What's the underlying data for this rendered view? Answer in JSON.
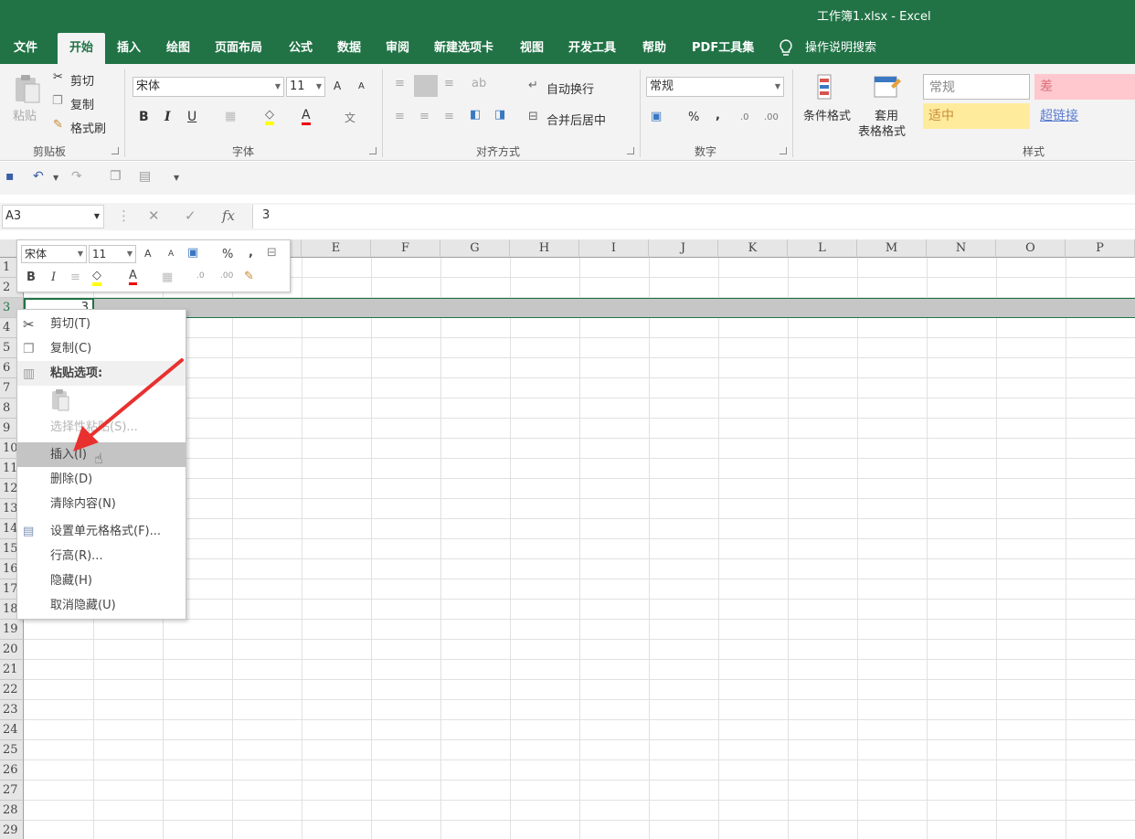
{
  "window": {
    "title": "工作簿1.xlsx  -  Excel"
  },
  "tabs": [
    {
      "label": "文件",
      "active": false
    },
    {
      "label": "开始",
      "active": true
    },
    {
      "label": "插入",
      "active": false
    },
    {
      "label": "绘图",
      "active": false
    },
    {
      "label": "页面布局",
      "active": false
    },
    {
      "label": "公式",
      "active": false
    },
    {
      "label": "数据",
      "active": false
    },
    {
      "label": "审阅",
      "active": false
    },
    {
      "label": "新建选项卡",
      "active": false
    },
    {
      "label": "视图",
      "active": false
    },
    {
      "label": "开发工具",
      "active": false
    },
    {
      "label": "帮助",
      "active": false
    },
    {
      "label": "PDF工具集",
      "active": false
    }
  ],
  "tell_me": "操作说明搜索",
  "ribbon": {
    "clipboard": {
      "paste": "粘贴",
      "cut": "剪切",
      "copy": "复制",
      "format_painter": "格式刷",
      "label": "剪贴板"
    },
    "font": {
      "name": "宋体",
      "size": "11",
      "grow": "A",
      "shrink": "A",
      "bold": "B",
      "italic": "I",
      "underline": "U",
      "font_color": "A",
      "phonetic": "文",
      "label": "字体"
    },
    "alignment": {
      "wrap_text": "自动换行",
      "merge_center": "合并后居中",
      "orientation": "ab",
      "label": "对齐方式"
    },
    "number": {
      "format": "常规",
      "percent": "%",
      "comma": ",",
      "inc_decimal": ".0",
      "dec_decimal": ".00",
      "label": "数字"
    },
    "styles": {
      "conditional": "条件格式",
      "table_line1": "套用",
      "table_line2": "表格格式",
      "normal": "常规",
      "bad": "差",
      "neutral": "适中",
      "hyperlink": "超链接",
      "label": "样式"
    }
  },
  "formula_bar": {
    "name_box": "A3",
    "fx": "fx",
    "value": "3"
  },
  "columns": [
    "E",
    "F",
    "G",
    "H",
    "I",
    "J",
    "K",
    "L",
    "M",
    "N",
    "O",
    "P"
  ],
  "rows": [
    "1",
    "2",
    "3",
    "4",
    "5",
    "6",
    "7",
    "8",
    "9",
    "10",
    "11",
    "12",
    "13",
    "14",
    "15",
    "16",
    "17",
    "18",
    "19",
    "20",
    "21",
    "22",
    "23",
    "24",
    "25",
    "26",
    "27",
    "28",
    "29"
  ],
  "active_cell": {
    "value": "3"
  },
  "mini_toolbar": {
    "font": "宋体",
    "size": "11",
    "grow": "A",
    "shrink": "A",
    "percent": "%",
    "comma": ",",
    "bold": "B",
    "italic": "I",
    "font_color": "A"
  },
  "context_menu": {
    "cut": "剪切(T)",
    "copy": "复制(C)",
    "paste_options": "粘贴选项:",
    "paste_special": "选择性粘贴(S)...",
    "insert": "插入(I)",
    "delete": "删除(D)",
    "clear": "清除内容(N)",
    "format_cells": "设置单元格格式(F)...",
    "row_height": "行高(R)...",
    "hide": "隐藏(H)",
    "unhide": "取消隐藏(U)"
  },
  "colors": {
    "brand": "#217346",
    "arrow": "#e8312f",
    "bad_bg": "#ffc7ce",
    "bad_fg": "#9c0006",
    "neutral_bg": "#ffeb9c",
    "neutral_fg": "#9c6500",
    "link": "#0563c1"
  }
}
